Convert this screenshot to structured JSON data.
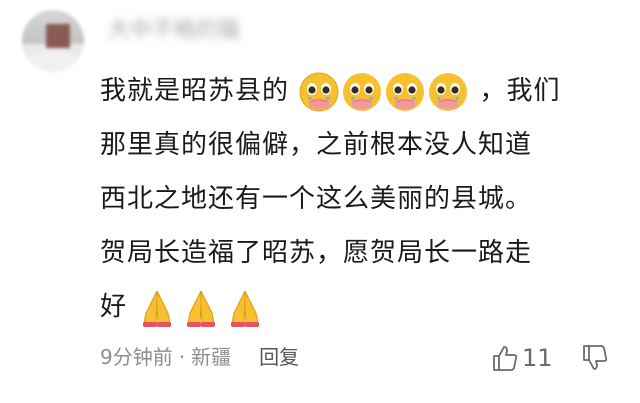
{
  "comment": {
    "username": "大中不格的猫",
    "lines": [
      {
        "text_before": "我就是昭苏县的",
        "emoji_count": 4,
        "text_after": "，我们"
      },
      {
        "text": "那里真的很偏僻，之前根本没人知道"
      },
      {
        "text": "西北之地还有一个这么美丽的县城。"
      },
      {
        "text": "贺局长造福了昭苏，愿贺局长一路走"
      },
      {
        "text_before": "好",
        "emoji_count": 3
      }
    ],
    "emoji_inline": "pleading-face-icon",
    "emoji_end": "folded-hands-icon"
  },
  "meta": {
    "time": "9分钟前",
    "separator": "·",
    "location": "新疆",
    "reply_label": "回复"
  },
  "actions": {
    "like_icon": "thumbs-up-outline-icon",
    "like_count": "11",
    "dislike_icon": "thumbs-down-outline-icon"
  },
  "colors": {
    "text": "#1a1a1a",
    "meta": "#8e8e8e",
    "emoji_yellow": "#f7c02e"
  }
}
